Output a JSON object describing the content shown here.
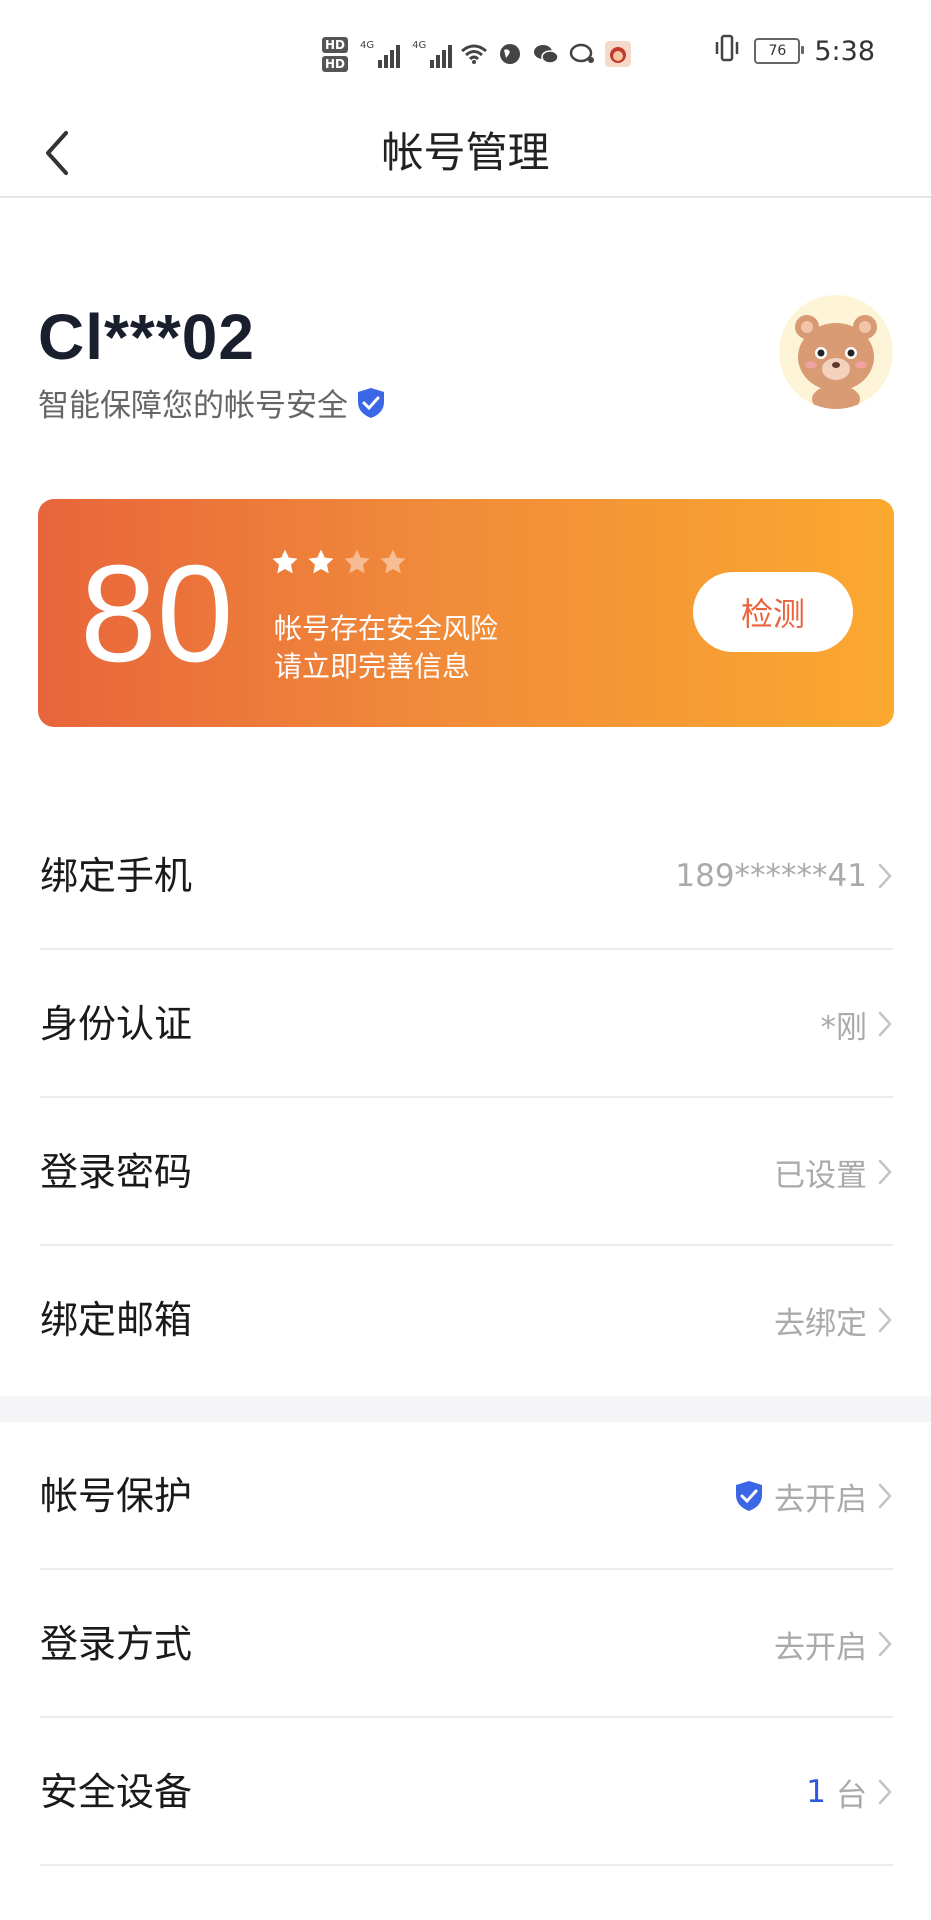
{
  "status_bar": {
    "hd1": "HD",
    "hd2": "HD",
    "sig1_label": "4G",
    "sig2_label": "4G",
    "battery": "76",
    "time": "5:38"
  },
  "nav": {
    "title": "帐号管理"
  },
  "account": {
    "name": "Cl***02",
    "subtitle": "智能保障您的帐号安全"
  },
  "score_card": {
    "score": "80",
    "stars_filled": 2,
    "stars_total": 4,
    "risk_line1": "帐号存在安全风险",
    "risk_line2": "请立即完善信息",
    "check_label": "检测",
    "gradient_start": "#e8653b",
    "gradient_end": "#fba92f"
  },
  "items": [
    {
      "label": "绑定手机",
      "value": "189******41"
    },
    {
      "label": "身份认证",
      "value": "*刚"
    },
    {
      "label": "登录密码",
      "value": "已设置"
    },
    {
      "label": "绑定邮箱",
      "value": "去绑定"
    },
    {
      "label": "帐号保护",
      "value": "去开启",
      "icon": "shield-check-icon"
    },
    {
      "label": "登录方式",
      "value": "去开启"
    },
    {
      "label": "安全设备",
      "value_num": "1",
      "value": "台"
    }
  ],
  "colors": {
    "accent_blue": "#3b66e6",
    "value_gray": "#aaaaaa",
    "check_text": "#e8643b"
  }
}
